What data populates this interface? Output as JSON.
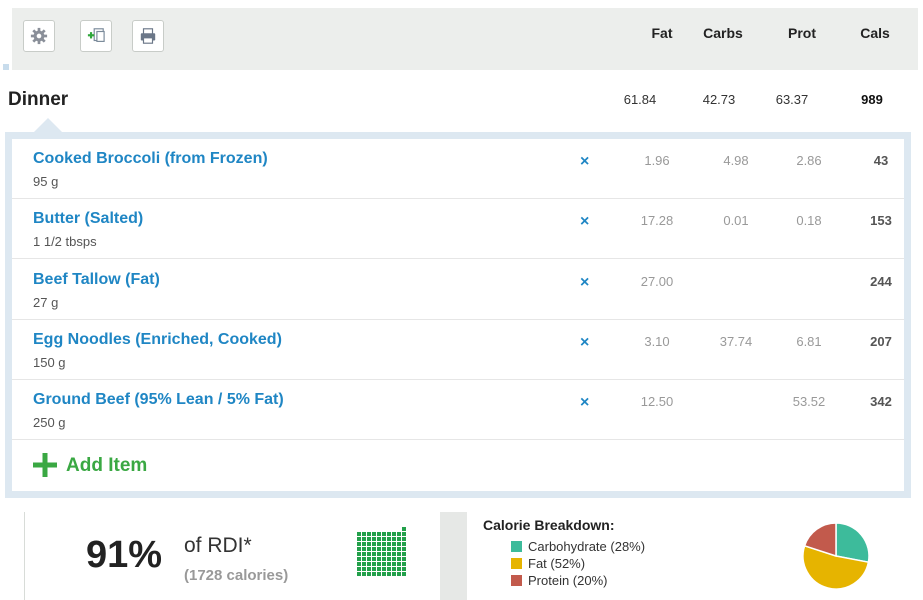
{
  "toolbar": {
    "buttons": [
      {
        "icon": "gear-icon"
      },
      {
        "icon": "add-copy-icon"
      },
      {
        "icon": "print-icon"
      }
    ],
    "columns": [
      "Fat",
      "Carbs",
      "Prot",
      "Cals"
    ]
  },
  "meal": {
    "title": "Dinner",
    "fat": "61.84",
    "carbs": "42.73",
    "prot": "63.37",
    "cals": "989"
  },
  "items": [
    {
      "name": "Cooked Broccoli (from Frozen)",
      "qty": "95 g",
      "fat": "1.96",
      "carbs": "4.98",
      "prot": "2.86",
      "cals": "43"
    },
    {
      "name": "Butter (Salted)",
      "qty": "1 1/2 tbsps",
      "fat": "17.28",
      "carbs": "0.01",
      "prot": "0.18",
      "cals": "153"
    },
    {
      "name": "Beef Tallow (Fat)",
      "qty": "27 g",
      "fat": "27.00",
      "carbs": "",
      "prot": "",
      "cals": "244"
    },
    {
      "name": "Egg Noodles (Enriched, Cooked)",
      "qty": "150 g",
      "fat": "3.10",
      "carbs": "37.74",
      "prot": "6.81",
      "cals": "207"
    },
    {
      "name": "Ground Beef (95% Lean / 5% Fat)",
      "qty": "250 g",
      "fat": "12.50",
      "carbs": "",
      "prot": "53.52",
      "cals": "342"
    }
  ],
  "delete_symbol": "×",
  "add_item_label": "Add Item",
  "summary": {
    "rdi_percent": "91%",
    "rdi_label": "of RDI*",
    "rdi_calories": "(1728 calories)",
    "rdi_fill_fraction": 0.91,
    "breakdown_title": "Calorie Breakdown:",
    "breakdown": [
      {
        "label": "Carbohydrate (28%)",
        "percent": 28,
        "color": "#3dbb9b"
      },
      {
        "label": "Fat (52%)",
        "percent": 52,
        "color": "#e6b400"
      },
      {
        "label": "Protein (20%)",
        "percent": 20,
        "color": "#c25a4c"
      }
    ]
  },
  "colors": {
    "link_blue": "#1f86c4",
    "add_green": "#3aa843",
    "waffle_green": "#22a04a"
  }
}
